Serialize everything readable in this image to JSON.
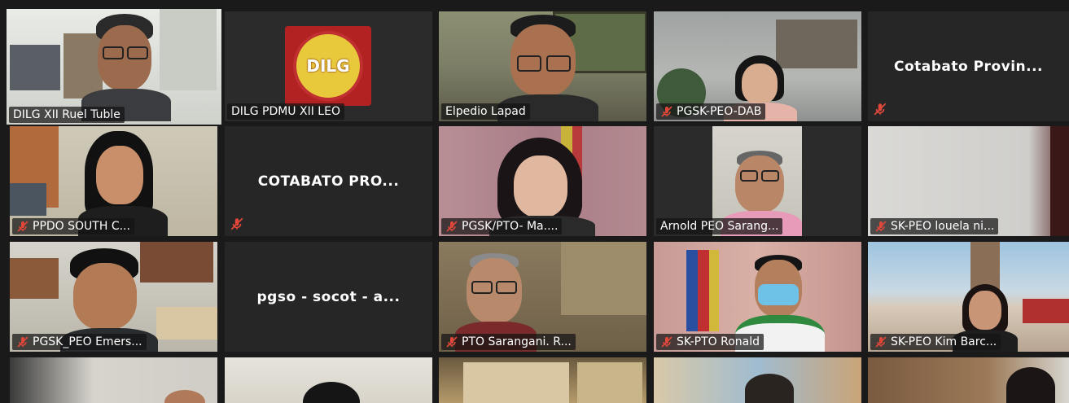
{
  "meeting": {
    "participants": [
      {
        "name": "DILG XII Ruel Tuble",
        "muted": false,
        "speaking": true,
        "video": true
      },
      {
        "name": "DILG PDMU XII LEO",
        "muted": false,
        "speaking": false,
        "video": true,
        "logo_text": "DILG"
      },
      {
        "name": "Elpedio Lapad",
        "muted": false,
        "speaking": false,
        "video": true
      },
      {
        "name": "PGSK-PEO-DAB",
        "muted": true,
        "speaking": false,
        "video": true
      },
      {
        "name": "Cotabato Provin...",
        "muted": true,
        "speaking": false,
        "video": false
      },
      {
        "name": "PPDO SOUTH C...",
        "muted": true,
        "speaking": false,
        "video": true
      },
      {
        "name": "COTABATO PRO...",
        "muted": true,
        "speaking": false,
        "video": false
      },
      {
        "name": "PGSK/PTO- Ma....",
        "muted": true,
        "speaking": false,
        "video": true
      },
      {
        "name": "Arnold PEO Sarang...",
        "muted": false,
        "speaking": false,
        "video": true
      },
      {
        "name": "SK-PEO louela ni...",
        "muted": true,
        "speaking": false,
        "video": true
      },
      {
        "name": "PGSK_PEO Emers...",
        "muted": true,
        "speaking": false,
        "video": true
      },
      {
        "name": "pgso - socot - a...",
        "muted": false,
        "speaking": false,
        "video": false
      },
      {
        "name": "PTO Sarangani. R...",
        "muted": true,
        "speaking": false,
        "video": true
      },
      {
        "name": "SK-PTO Ronald",
        "muted": true,
        "speaking": false,
        "video": true
      },
      {
        "name": "SK-PEO Kim Barc...",
        "muted": true,
        "speaking": false,
        "video": true
      }
    ]
  },
  "colors": {
    "speaking_border": "#c8e063",
    "mute_icon": "#e0473a",
    "tile_background": "#262626"
  }
}
